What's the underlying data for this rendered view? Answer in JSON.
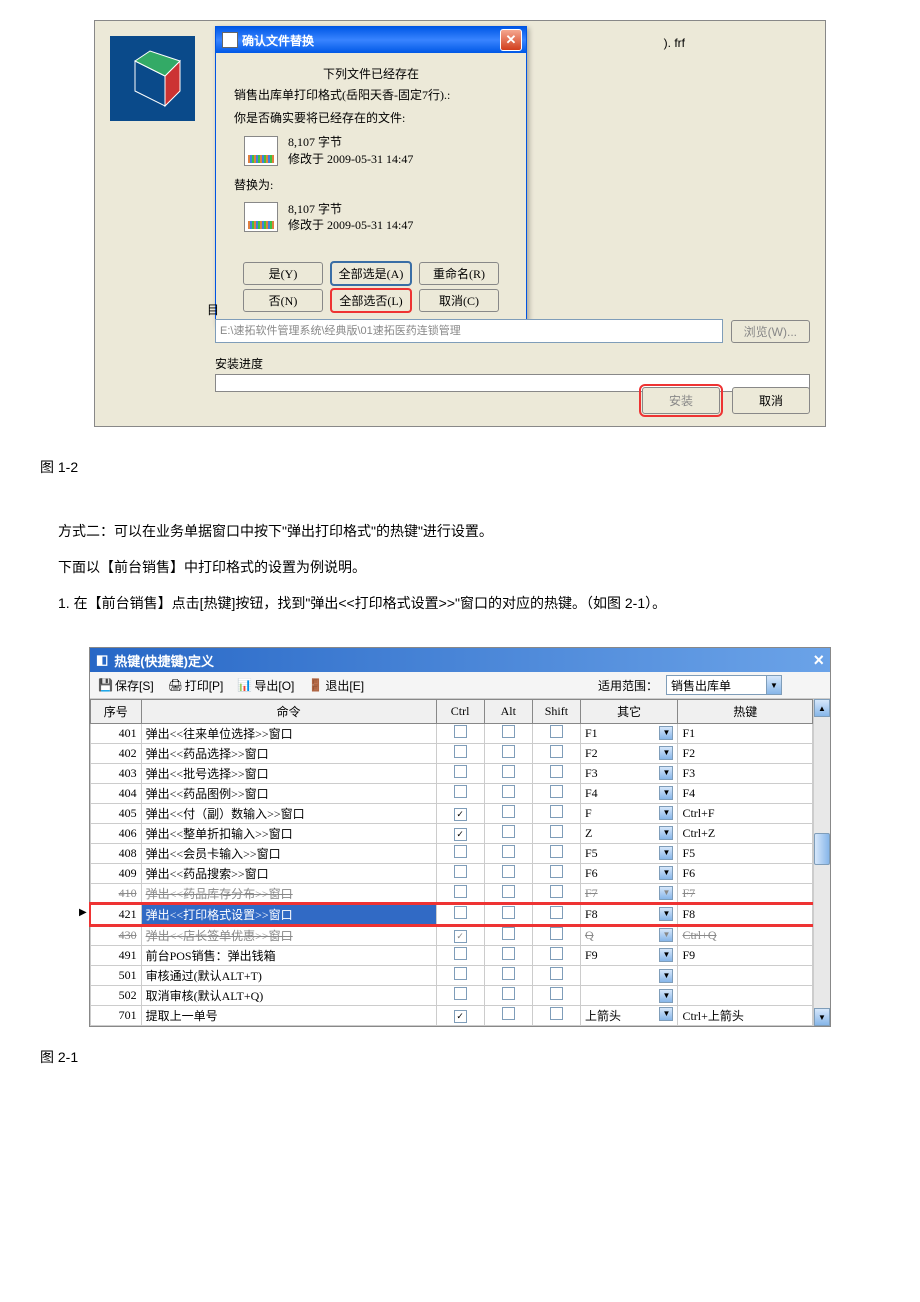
{
  "installer": {
    "fileExt": "). frf",
    "dialog": {
      "title": "确认文件替换",
      "msg1": "下列文件已经存在",
      "msg2": "销售出库单打印格式(岳阳天香-固定7行).:",
      "msg3": "你是否确实要将已经存在的文件:",
      "file1_size": "8,107 字节",
      "file1_date": "修改于 2009-05-31 14:47",
      "msg4": "替换为:",
      "file2_size": "8,107 字节",
      "file2_date": "修改于 2009-05-31 14:47",
      "btnYes": "是(Y)",
      "btnAllYes": "全部选是(A)",
      "btnRename": "重命名(R)",
      "btnNo": "否(N)",
      "btnAllNo": "全部选否(L)",
      "btnCancel": "取消(C)"
    },
    "targetLabel": "目",
    "path": "E:\\速拓软件管理系统\\经典版\\01速拓医药连锁管理",
    "browseBtn": "浏览(W)...",
    "progressLabel": "安装进度",
    "installBtn": "安装",
    "cancelBtn": "取消"
  },
  "fig1Label": "图 1-2",
  "text": {
    "p1": "方式二：可以在业务单据窗口中按下\"弹出打印格式\"的热键\"进行设置。",
    "p2": "下面以【前台销售】中打印格式的设置为例说明。",
    "p3": "1. 在【前台销售】点击[热键]按钮，找到\"弹出<<打印格式设置>>\"窗口的对应的热键。（如图 2-1）。"
  },
  "hotkey": {
    "title": "热键(快捷键)定义",
    "toolbar": {
      "save": "保存[S]",
      "print": "打印[P]",
      "export": "导出[O]",
      "exit": "退出[E]",
      "scopeLabel": "适用范围：",
      "scopeValue": "销售出库单"
    },
    "headers": {
      "seq": "序号",
      "cmd": "命令",
      "ctrl": "Ctrl",
      "alt": "Alt",
      "shift": "Shift",
      "other": "其它",
      "hotkey": "热键"
    },
    "rows": [
      {
        "seq": "401",
        "cmd": "弹出<<往来单位选择>>窗口",
        "ctrl": false,
        "alt": false,
        "shift": false,
        "other": "F1",
        "hotkey": "F1"
      },
      {
        "seq": "402",
        "cmd": "弹出<<药品选择>>窗口",
        "ctrl": false,
        "alt": false,
        "shift": false,
        "other": "F2",
        "hotkey": "F2"
      },
      {
        "seq": "403",
        "cmd": "弹出<<批号选择>>窗口",
        "ctrl": false,
        "alt": false,
        "shift": false,
        "other": "F3",
        "hotkey": "F3"
      },
      {
        "seq": "404",
        "cmd": "弹出<<药品图例>>窗口",
        "ctrl": false,
        "alt": false,
        "shift": false,
        "other": "F4",
        "hotkey": "F4"
      },
      {
        "seq": "405",
        "cmd": "弹出<<付（副）数输入>>窗口",
        "ctrl": true,
        "alt": false,
        "shift": false,
        "other": "F",
        "hotkey": "Ctrl+F"
      },
      {
        "seq": "406",
        "cmd": "弹出<<整单折扣输入>>窗口",
        "ctrl": true,
        "alt": false,
        "shift": false,
        "other": "Z",
        "hotkey": "Ctrl+Z"
      },
      {
        "seq": "408",
        "cmd": "弹出<<会员卡输入>>窗口",
        "ctrl": false,
        "alt": false,
        "shift": false,
        "other": "F5",
        "hotkey": "F5"
      },
      {
        "seq": "409",
        "cmd": "弹出<<药品搜索>>窗口",
        "ctrl": false,
        "alt": false,
        "shift": false,
        "other": "F6",
        "hotkey": "F6"
      },
      {
        "seq": "410",
        "cmd": "弹出<<药品库存分布>>窗口",
        "ctrl": false,
        "alt": false,
        "shift": false,
        "other": "F7",
        "hotkey": "F7",
        "strike": true
      },
      {
        "seq": "421",
        "cmd": "弹出<<打印格式设置>>窗口",
        "ctrl": false,
        "alt": false,
        "shift": false,
        "other": "F8",
        "hotkey": "F8",
        "selected": true
      },
      {
        "seq": "430",
        "cmd": "弹出<<店长签单优惠>>窗口",
        "ctrl": true,
        "alt": false,
        "shift": false,
        "other": "Q",
        "hotkey": "Ctrl+Q",
        "strike": true
      },
      {
        "seq": "491",
        "cmd": "前台POS销售：弹出钱箱",
        "ctrl": false,
        "alt": false,
        "shift": false,
        "other": "F9",
        "hotkey": "F9"
      },
      {
        "seq": "501",
        "cmd": "审核通过(默认ALT+T)",
        "ctrl": false,
        "alt": false,
        "shift": false,
        "other": "",
        "hotkey": ""
      },
      {
        "seq": "502",
        "cmd": "取消审核(默认ALT+Q)",
        "ctrl": false,
        "alt": false,
        "shift": false,
        "other": "",
        "hotkey": ""
      },
      {
        "seq": "701",
        "cmd": "提取上一单号",
        "ctrl": true,
        "alt": false,
        "shift": false,
        "other": "上箭头",
        "hotkey": "Ctrl+上箭头"
      }
    ]
  },
  "fig2Label": "图 2-1"
}
